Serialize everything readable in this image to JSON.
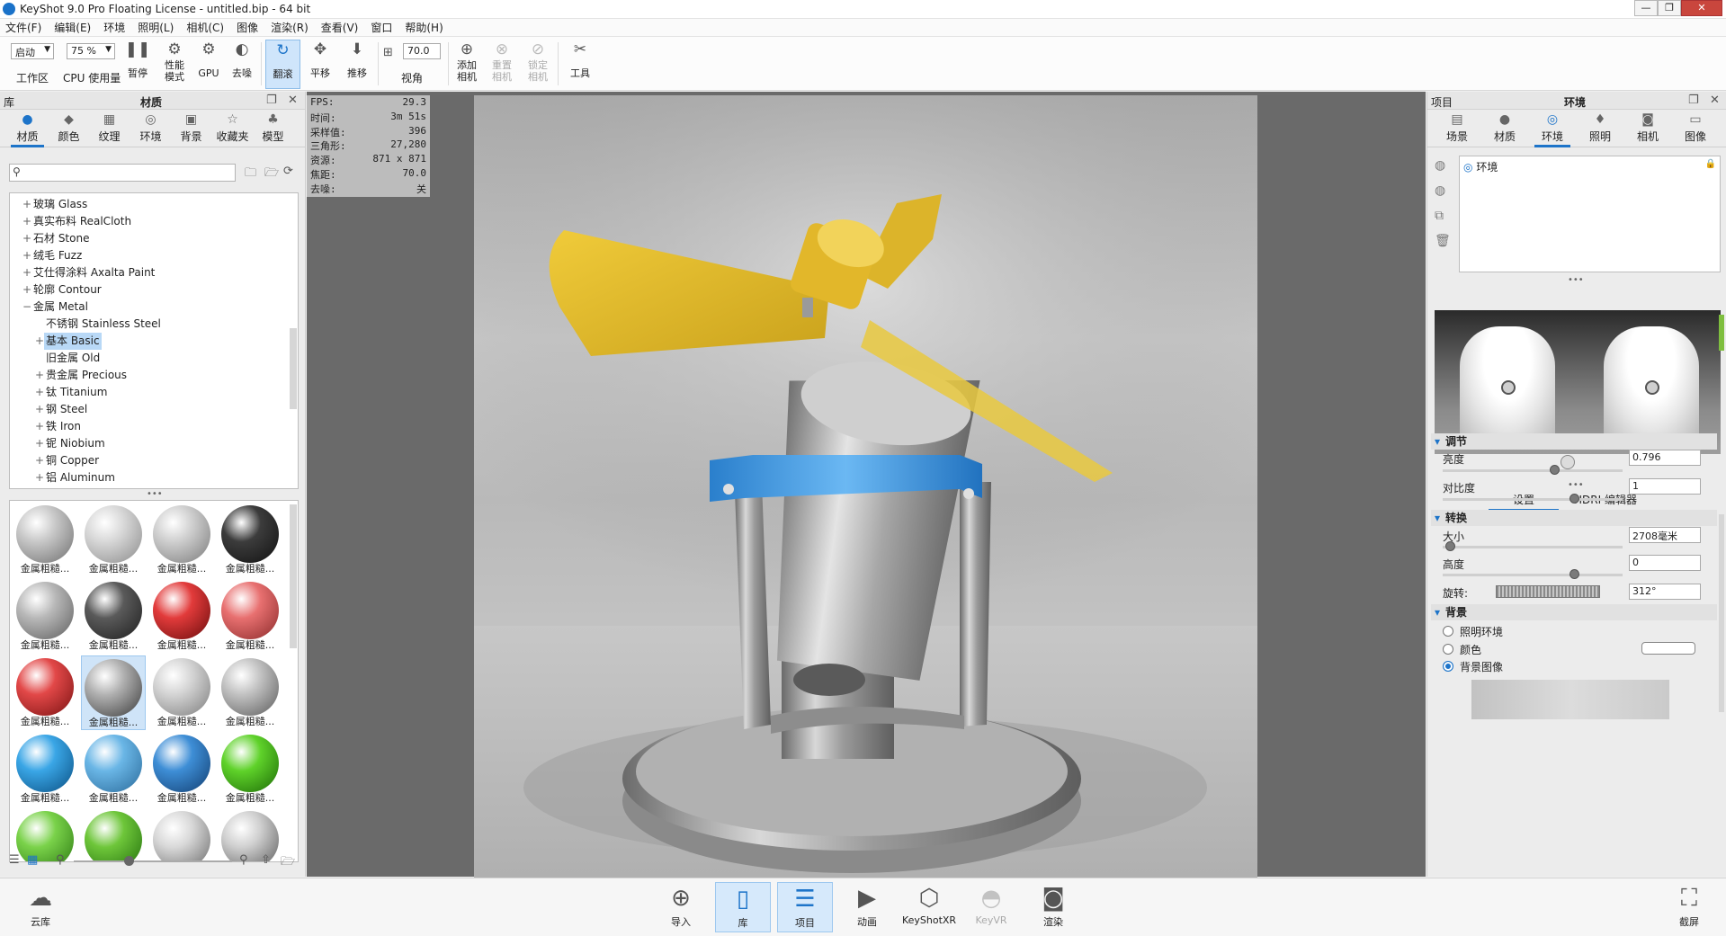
{
  "window": {
    "title": "KeyShot 9.0 Pro Floating License  - untitled.bip  - 64 bit",
    "controls": [
      "—",
      "❐",
      "✕"
    ]
  },
  "menu": [
    "文件(F)",
    "编辑(E)",
    "环境",
    "照明(L)",
    "相机(C)",
    "图像",
    "渲染(R)",
    "查看(V)",
    "窗口",
    "帮助(H)"
  ],
  "toolbar": {
    "workspace_value": "启动",
    "workspace_label": "工作区",
    "cpu_value": "75 %",
    "cpu_label": "CPU 使用量",
    "pause": "暂停",
    "performance": "性能\n模式",
    "gpu": "GPU",
    "denoise": "去噪",
    "tumble": "翻滚",
    "pan": "平移",
    "dolly": "推移",
    "fov_value": "70.0",
    "fov_label": "视角",
    "add_camera": "添加\n相机",
    "reset_camera": "重置\n相机",
    "lock_camera": "锁定\n相机",
    "tools": "工具"
  },
  "library": {
    "header_left": "库",
    "header_title": "材质",
    "tabs": [
      "材质",
      "颜色",
      "纹理",
      "环境",
      "背景",
      "收藏夹",
      "模型"
    ],
    "tree": [
      {
        "label": "玻璃 Glass",
        "exp": "+",
        "indent": 0
      },
      {
        "label": "真实布料 RealCloth",
        "exp": "+",
        "indent": 0
      },
      {
        "label": "石材 Stone",
        "exp": "+",
        "indent": 0
      },
      {
        "label": "绒毛 Fuzz",
        "exp": "+",
        "indent": 0
      },
      {
        "label": "艾仕得涂料 Axalta Paint",
        "exp": "+",
        "indent": 0
      },
      {
        "label": "轮廓 Contour",
        "exp": "+",
        "indent": 0
      },
      {
        "label": "金属 Metal",
        "exp": "−",
        "indent": 0
      },
      {
        "label": "不锈钢 Stainless Steel",
        "exp": "",
        "indent": 1
      },
      {
        "label": "基本 Basic",
        "exp": "+",
        "indent": 1,
        "selected": true
      },
      {
        "label": "旧金属 Old",
        "exp": "",
        "indent": 1
      },
      {
        "label": "贵金属 Precious",
        "exp": "+",
        "indent": 1
      },
      {
        "label": "钛 Titanium",
        "exp": "+",
        "indent": 1
      },
      {
        "label": "钢 Steel",
        "exp": "+",
        "indent": 1
      },
      {
        "label": "铁 Iron",
        "exp": "+",
        "indent": 1
      },
      {
        "label": "铌 Niobium",
        "exp": "+",
        "indent": 1
      },
      {
        "label": "铜 Copper",
        "exp": "+",
        "indent": 1
      },
      {
        "label": "铝 Aluminum",
        "exp": "+",
        "indent": 1
      }
    ],
    "thumb_label": "金属粗糙...",
    "thumbs": [
      {
        "c": "#c8c8c8",
        "d": "#6e6e6e"
      },
      {
        "c": "#d8d8d8",
        "d": "#8a8a8a"
      },
      {
        "c": "#cfcfcf",
        "d": "#7a7a7a"
      },
      {
        "c": "#3c3c3c",
        "d": "#111111"
      },
      {
        "c": "#b8b8b8",
        "d": "#5e5e5e"
      },
      {
        "c": "#5a5a5a",
        "d": "#1e1e1e"
      },
      {
        "c": "#e23b3b",
        "d": "#6a0c0c"
      },
      {
        "c": "#e87070",
        "d": "#8a2a2a"
      },
      {
        "c": "#e24848",
        "d": "#7a1212"
      },
      {
        "c": "#b0b0b0",
        "d": "#3a3a3a",
        "sel": true
      },
      {
        "c": "#d4d4d4",
        "d": "#7c7c7c"
      },
      {
        "c": "#c2c2c2",
        "d": "#5a5a5a"
      },
      {
        "c": "#3aa6e6",
        "d": "#0a4f82"
      },
      {
        "c": "#6ab6e6",
        "d": "#2a6a9a"
      },
      {
        "c": "#3e8ed6",
        "d": "#123e70"
      },
      {
        "c": "#5fd22a",
        "d": "#1c6a06"
      },
      {
        "c": "#7ad24a",
        "d": "#2c7a12"
      },
      {
        "c": "#6ec63a",
        "d": "#23700c"
      },
      {
        "c": "#d8d8d8",
        "d": "#6a6a6a"
      },
      {
        "c": "#cfcfcf",
        "d": "#5a5a5a"
      }
    ]
  },
  "stats": [
    {
      "k": "FPS:",
      "v": "29.3"
    },
    {
      "k": "时间:",
      "v": "3m 51s"
    },
    {
      "k": "采样值:",
      "v": "396"
    },
    {
      "k": "三角形:",
      "v": "27,280"
    },
    {
      "k": "资源:",
      "v": "871 x 871"
    },
    {
      "k": "焦距:",
      "v": "70.0"
    },
    {
      "k": "去噪:",
      "v": "关"
    }
  ],
  "project": {
    "header_left": "项目",
    "header_title": "环境",
    "tabs": [
      "场景",
      "材质",
      "环境",
      "照明",
      "相机",
      "图像"
    ],
    "tree_item": "环境",
    "subtabs": [
      "设置",
      "HDRI 编辑器"
    ],
    "adjust": {
      "title": "调节",
      "brightness_label": "亮度",
      "brightness_value": "0.796",
      "brightness_pos": 0.62,
      "contrast_label": "对比度",
      "contrast_value": "1",
      "contrast_pos": 0.73
    },
    "transform": {
      "title": "转换",
      "size_label": "大小",
      "size_value": "2708毫米",
      "size_pos": 0.04,
      "height_label": "高度",
      "height_value": "0",
      "height_pos": 0.73,
      "rotate_label": "旋转:",
      "rotate_value": "312°"
    },
    "background": {
      "title": "背景",
      "options": [
        "照明环境",
        "颜色",
        "背景图像"
      ],
      "selected": 2
    }
  },
  "bottom": {
    "cloud": "云库",
    "import": "导入",
    "library": "库",
    "project": "项目",
    "animation": "动画",
    "keyshotxr": "KeyShotXR",
    "keyvr": "KeyVR",
    "render": "渲染",
    "screenshot": "截屏"
  },
  "colors": {
    "accent": "#1d74c9",
    "blade_yellow": "#e7c02d",
    "bracket_blue": "#2a8fe0"
  }
}
